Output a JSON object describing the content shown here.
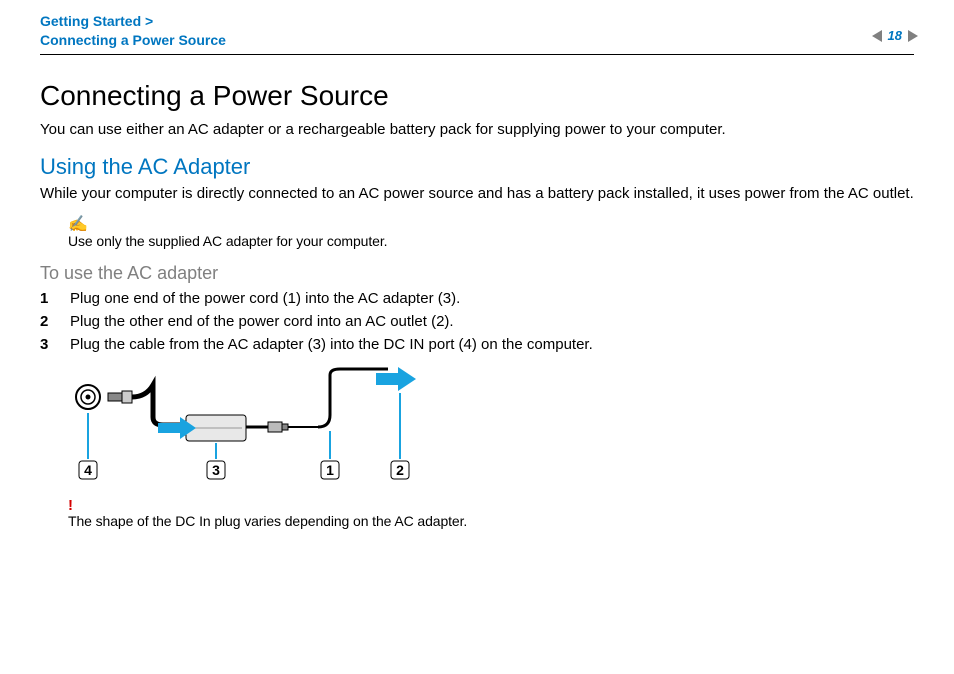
{
  "header": {
    "breadcrumb_section": "Getting Started >",
    "breadcrumb_page": "Connecting a Power Source",
    "page_number": "18"
  },
  "main": {
    "title": "Connecting a Power Source",
    "intro": "You can use either an AC adapter or a rechargeable battery pack for supplying power to your computer.",
    "subheading": "Using the AC Adapter",
    "sub_body": "While your computer is directly connected to an AC power source and has a battery pack installed, it uses power from the AC outlet.",
    "note_icon": "✍",
    "note_text": "Use only the supplied AC adapter for your computer.",
    "task_heading": "To use the AC adapter",
    "steps": [
      {
        "n": "1",
        "text": "Plug one end of the power cord (1) into the AC adapter (3)."
      },
      {
        "n": "2",
        "text": "Plug the other end of the power cord into an AC outlet (2)."
      },
      {
        "n": "3",
        "text": "Plug the cable from the AC adapter (3) into the DC IN port (4) on the computer."
      }
    ],
    "diagram_labels": {
      "l1": "1",
      "l2": "2",
      "l3": "3",
      "l4": "4"
    },
    "warning_mark": "!",
    "warning_text": "The shape of the DC In plug varies depending on the AC adapter."
  }
}
